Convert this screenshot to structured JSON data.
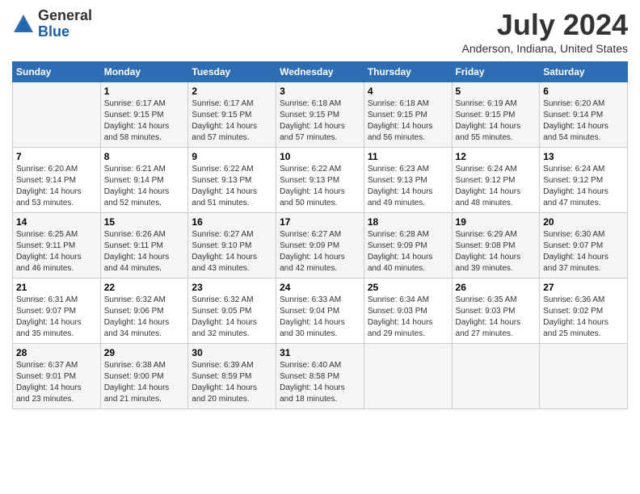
{
  "logo": {
    "general": "General",
    "blue": "Blue"
  },
  "title": "July 2024",
  "subtitle": "Anderson, Indiana, United States",
  "days_of_week": [
    "Sunday",
    "Monday",
    "Tuesday",
    "Wednesday",
    "Thursday",
    "Friday",
    "Saturday"
  ],
  "weeks": [
    [
      {
        "day": "",
        "sunrise": "",
        "sunset": "",
        "daylight": ""
      },
      {
        "day": "1",
        "sunrise": "Sunrise: 6:17 AM",
        "sunset": "Sunset: 9:15 PM",
        "daylight": "Daylight: 14 hours and 58 minutes."
      },
      {
        "day": "2",
        "sunrise": "Sunrise: 6:17 AM",
        "sunset": "Sunset: 9:15 PM",
        "daylight": "Daylight: 14 hours and 57 minutes."
      },
      {
        "day": "3",
        "sunrise": "Sunrise: 6:18 AM",
        "sunset": "Sunset: 9:15 PM",
        "daylight": "Daylight: 14 hours and 57 minutes."
      },
      {
        "day": "4",
        "sunrise": "Sunrise: 6:18 AM",
        "sunset": "Sunset: 9:15 PM",
        "daylight": "Daylight: 14 hours and 56 minutes."
      },
      {
        "day": "5",
        "sunrise": "Sunrise: 6:19 AM",
        "sunset": "Sunset: 9:15 PM",
        "daylight": "Daylight: 14 hours and 55 minutes."
      },
      {
        "day": "6",
        "sunrise": "Sunrise: 6:20 AM",
        "sunset": "Sunset: 9:14 PM",
        "daylight": "Daylight: 14 hours and 54 minutes."
      }
    ],
    [
      {
        "day": "7",
        "sunrise": "Sunrise: 6:20 AM",
        "sunset": "Sunset: 9:14 PM",
        "daylight": "Daylight: 14 hours and 53 minutes."
      },
      {
        "day": "8",
        "sunrise": "Sunrise: 6:21 AM",
        "sunset": "Sunset: 9:14 PM",
        "daylight": "Daylight: 14 hours and 52 minutes."
      },
      {
        "day": "9",
        "sunrise": "Sunrise: 6:22 AM",
        "sunset": "Sunset: 9:13 PM",
        "daylight": "Daylight: 14 hours and 51 minutes."
      },
      {
        "day": "10",
        "sunrise": "Sunrise: 6:22 AM",
        "sunset": "Sunset: 9:13 PM",
        "daylight": "Daylight: 14 hours and 50 minutes."
      },
      {
        "day": "11",
        "sunrise": "Sunrise: 6:23 AM",
        "sunset": "Sunset: 9:13 PM",
        "daylight": "Daylight: 14 hours and 49 minutes."
      },
      {
        "day": "12",
        "sunrise": "Sunrise: 6:24 AM",
        "sunset": "Sunset: 9:12 PM",
        "daylight": "Daylight: 14 hours and 48 minutes."
      },
      {
        "day": "13",
        "sunrise": "Sunrise: 6:24 AM",
        "sunset": "Sunset: 9:12 PM",
        "daylight": "Daylight: 14 hours and 47 minutes."
      }
    ],
    [
      {
        "day": "14",
        "sunrise": "Sunrise: 6:25 AM",
        "sunset": "Sunset: 9:11 PM",
        "daylight": "Daylight: 14 hours and 46 minutes."
      },
      {
        "day": "15",
        "sunrise": "Sunrise: 6:26 AM",
        "sunset": "Sunset: 9:11 PM",
        "daylight": "Daylight: 14 hours and 44 minutes."
      },
      {
        "day": "16",
        "sunrise": "Sunrise: 6:27 AM",
        "sunset": "Sunset: 9:10 PM",
        "daylight": "Daylight: 14 hours and 43 minutes."
      },
      {
        "day": "17",
        "sunrise": "Sunrise: 6:27 AM",
        "sunset": "Sunset: 9:09 PM",
        "daylight": "Daylight: 14 hours and 42 minutes."
      },
      {
        "day": "18",
        "sunrise": "Sunrise: 6:28 AM",
        "sunset": "Sunset: 9:09 PM",
        "daylight": "Daylight: 14 hours and 40 minutes."
      },
      {
        "day": "19",
        "sunrise": "Sunrise: 6:29 AM",
        "sunset": "Sunset: 9:08 PM",
        "daylight": "Daylight: 14 hours and 39 minutes."
      },
      {
        "day": "20",
        "sunrise": "Sunrise: 6:30 AM",
        "sunset": "Sunset: 9:07 PM",
        "daylight": "Daylight: 14 hours and 37 minutes."
      }
    ],
    [
      {
        "day": "21",
        "sunrise": "Sunrise: 6:31 AM",
        "sunset": "Sunset: 9:07 PM",
        "daylight": "Daylight: 14 hours and 35 minutes."
      },
      {
        "day": "22",
        "sunrise": "Sunrise: 6:32 AM",
        "sunset": "Sunset: 9:06 PM",
        "daylight": "Daylight: 14 hours and 34 minutes."
      },
      {
        "day": "23",
        "sunrise": "Sunrise: 6:32 AM",
        "sunset": "Sunset: 9:05 PM",
        "daylight": "Daylight: 14 hours and 32 minutes."
      },
      {
        "day": "24",
        "sunrise": "Sunrise: 6:33 AM",
        "sunset": "Sunset: 9:04 PM",
        "daylight": "Daylight: 14 hours and 30 minutes."
      },
      {
        "day": "25",
        "sunrise": "Sunrise: 6:34 AM",
        "sunset": "Sunset: 9:03 PM",
        "daylight": "Daylight: 14 hours and 29 minutes."
      },
      {
        "day": "26",
        "sunrise": "Sunrise: 6:35 AM",
        "sunset": "Sunset: 9:03 PM",
        "daylight": "Daylight: 14 hours and 27 minutes."
      },
      {
        "day": "27",
        "sunrise": "Sunrise: 6:36 AM",
        "sunset": "Sunset: 9:02 PM",
        "daylight": "Daylight: 14 hours and 25 minutes."
      }
    ],
    [
      {
        "day": "28",
        "sunrise": "Sunrise: 6:37 AM",
        "sunset": "Sunset: 9:01 PM",
        "daylight": "Daylight: 14 hours and 23 minutes."
      },
      {
        "day": "29",
        "sunrise": "Sunrise: 6:38 AM",
        "sunset": "Sunset: 9:00 PM",
        "daylight": "Daylight: 14 hours and 21 minutes."
      },
      {
        "day": "30",
        "sunrise": "Sunrise: 6:39 AM",
        "sunset": "Sunset: 8:59 PM",
        "daylight": "Daylight: 14 hours and 20 minutes."
      },
      {
        "day": "31",
        "sunrise": "Sunrise: 6:40 AM",
        "sunset": "Sunset: 8:58 PM",
        "daylight": "Daylight: 14 hours and 18 minutes."
      },
      {
        "day": "",
        "sunrise": "",
        "sunset": "",
        "daylight": ""
      },
      {
        "day": "",
        "sunrise": "",
        "sunset": "",
        "daylight": ""
      },
      {
        "day": "",
        "sunrise": "",
        "sunset": "",
        "daylight": ""
      }
    ]
  ]
}
